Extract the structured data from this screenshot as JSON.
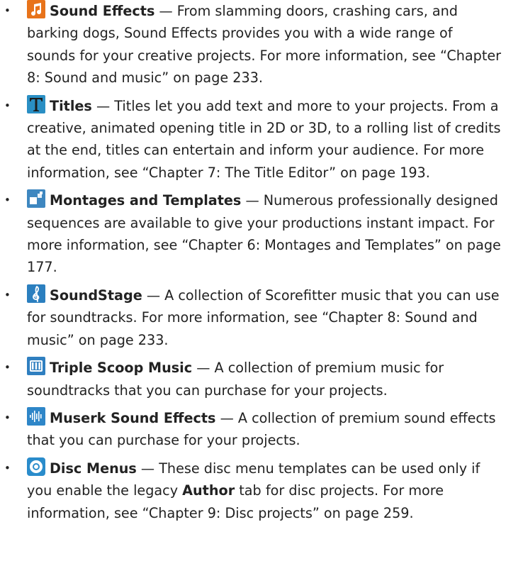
{
  "bullet_char": "•",
  "items": [
    {
      "icon": "music-note-icon",
      "term": "Sound Effects",
      "text": " — From slamming doors, crashing cars, and barking dogs, Sound Effects provides you with a wide range of sounds for your creative projects. For more information, see “Chapter 8: Sound and music” on page 233."
    },
    {
      "icon": "title-t-icon",
      "term": "Titles",
      "text": " — Titles let you add text and more to your projects. From a creative, animated opening title in 2D or 3D, to a rolling list of credits at the end, titles can entertain and inform your audience. For more information, see “Chapter 7: The Title Editor” on page 193."
    },
    {
      "icon": "montage-icon",
      "term": "Montages and Templates",
      "text": " — Numerous professionally designed sequences are available to give your productions instant impact. For more information, see “Chapter 6: Montages and Templates” on page 177."
    },
    {
      "icon": "treble-clef-icon",
      "term": "SoundStage",
      "text": " — A collection of Scorefitter music that you can use for soundtracks. For more information, see “Chapter 8: Sound and music” on page 233."
    },
    {
      "icon": "piano-keys-icon",
      "term": "Triple Scoop Music",
      "text": " — A collection of premium music for soundtracks that you can purchase for your projects."
    },
    {
      "icon": "waveform-icon",
      "term": "Muserk Sound Effects",
      "text": " — A collection of premium sound effects that you can purchase for your projects."
    },
    {
      "icon": "disc-icon",
      "term": "Disc Menus",
      "text_before": " — These disc menu templates can be used only if you enable the legacy ",
      "keyword": "Author",
      "text_after": " tab for disc projects. For more information, see “Chapter 9: Disc projects” on page 259."
    }
  ]
}
